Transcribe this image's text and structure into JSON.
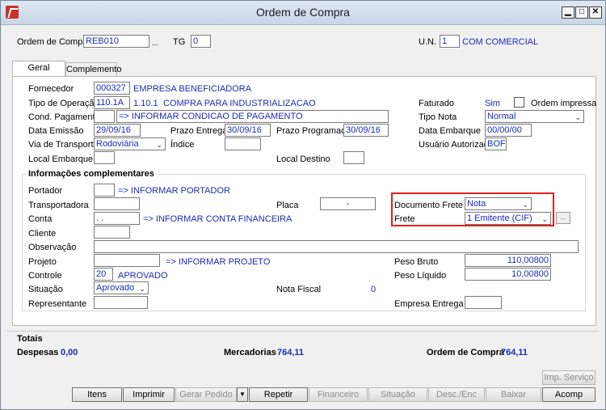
{
  "window": {
    "title": "Ordem de Compra"
  },
  "header": {
    "ordem_label": "Ordem de Compra",
    "ordem_value": "REB010",
    "ordem_dots": "...",
    "tg_label": "TG",
    "tg_value": "0",
    "un_label": "U.N.",
    "un_value": "1",
    "un_desc": "COM COMERCIAL"
  },
  "tabs": [
    "Geral",
    "Complemento"
  ],
  "form": {
    "fornecedor_label": "Fornecedor",
    "fornecedor_code": "000327",
    "fornecedor_name": "EMPRESA BENEFICIADORA",
    "tipo_op_label": "Tipo de Operação",
    "tipo_op_code": "110.1A",
    "tipo_op_num": "1.10.1",
    "tipo_op_desc": "COMPRA PARA INDUSTRIALIZACAO",
    "faturado_label": "Faturado",
    "faturado_value": "Sim",
    "ordem_impressa_label": "Ordem impressa",
    "cond_pag_label": "Cond. Pagamento",
    "cond_pag_value": "=> INFORMAR CONDICAO DE PAGAMENTO",
    "tipo_nota_label": "Tipo Nota",
    "tipo_nota_value": "Normal",
    "data_emissao_label": "Data Emissão",
    "data_emissao_value": "29/09/16",
    "prazo_entrega_label": "Prazo Entrega",
    "prazo_entrega_value": "30/09/16",
    "prazo_programado_label": "Prazo Programado",
    "prazo_programado_value": "30/09/16",
    "data_embarque_label": "Data Embarque",
    "data_embarque_value": "00/00/00",
    "via_transporte_label": "Via de Transporte",
    "via_transporte_value": "Rodoviária",
    "indice_label": "Índice",
    "usuario_label": "Usuário Autorizado",
    "usuario_value": "BOF",
    "local_embarque_label": "Local Embarque",
    "local_destino_label": "Local Destino"
  },
  "info": {
    "section_title": "Informações complementares",
    "portador_label": "Portador",
    "portador_text": "=> INFORMAR PORTADOR",
    "transportadora_label": "Transportadora",
    "placa_label": "Placa",
    "placa_value": "-",
    "doc_frete_label": "Documento Frete",
    "doc_frete_value": "Nota",
    "conta_label": "Conta",
    "conta_value": ". .",
    "conta_text": "=> INFORMAR CONTA FINANCEIRA",
    "frete_label": "Frete",
    "frete_value": "1 Emitente (CIF)",
    "frete_btn": "...",
    "cliente_label": "Cliente",
    "observacao_label": "Observação",
    "projeto_label": "Projeto",
    "projeto_text": "=> INFORMAR PROJETO",
    "peso_bruto_label": "Peso Bruto",
    "peso_bruto_value": "110,00800",
    "controle_label": "Controle",
    "controle_value": "20",
    "controle_status": "APROVADO",
    "peso_liquido_label": "Peso Líquido",
    "peso_liquido_value": "10,00800",
    "situacao_label": "Situação",
    "situacao_value": "Aprovado",
    "nota_fiscal_label": "Nota Fiscal",
    "nota_fiscal_value": "0",
    "representante_label": "Representante",
    "empresa_entrega_label": "Empresa Entrega"
  },
  "totais": {
    "title": "Totais",
    "despesas_label": "Despesas",
    "despesas_value": "0,00",
    "mercadorias_label": "Mercadorias",
    "mercadorias_value": "764,11",
    "ordem_label": "Ordem de Compra",
    "ordem_value": "764,11"
  },
  "buttons": {
    "imp_servico": "Imp. Serviço",
    "itens": "Itens",
    "imprimir": "Imprimir",
    "gerar_pedido": "Gerar Pedido",
    "repetir": "Repetir",
    "financeiro": "Financeiro",
    "situacao": "Situação",
    "desc_enc": "Desc./Enc",
    "baixar": "Baixar",
    "acomp": "Acomp"
  }
}
